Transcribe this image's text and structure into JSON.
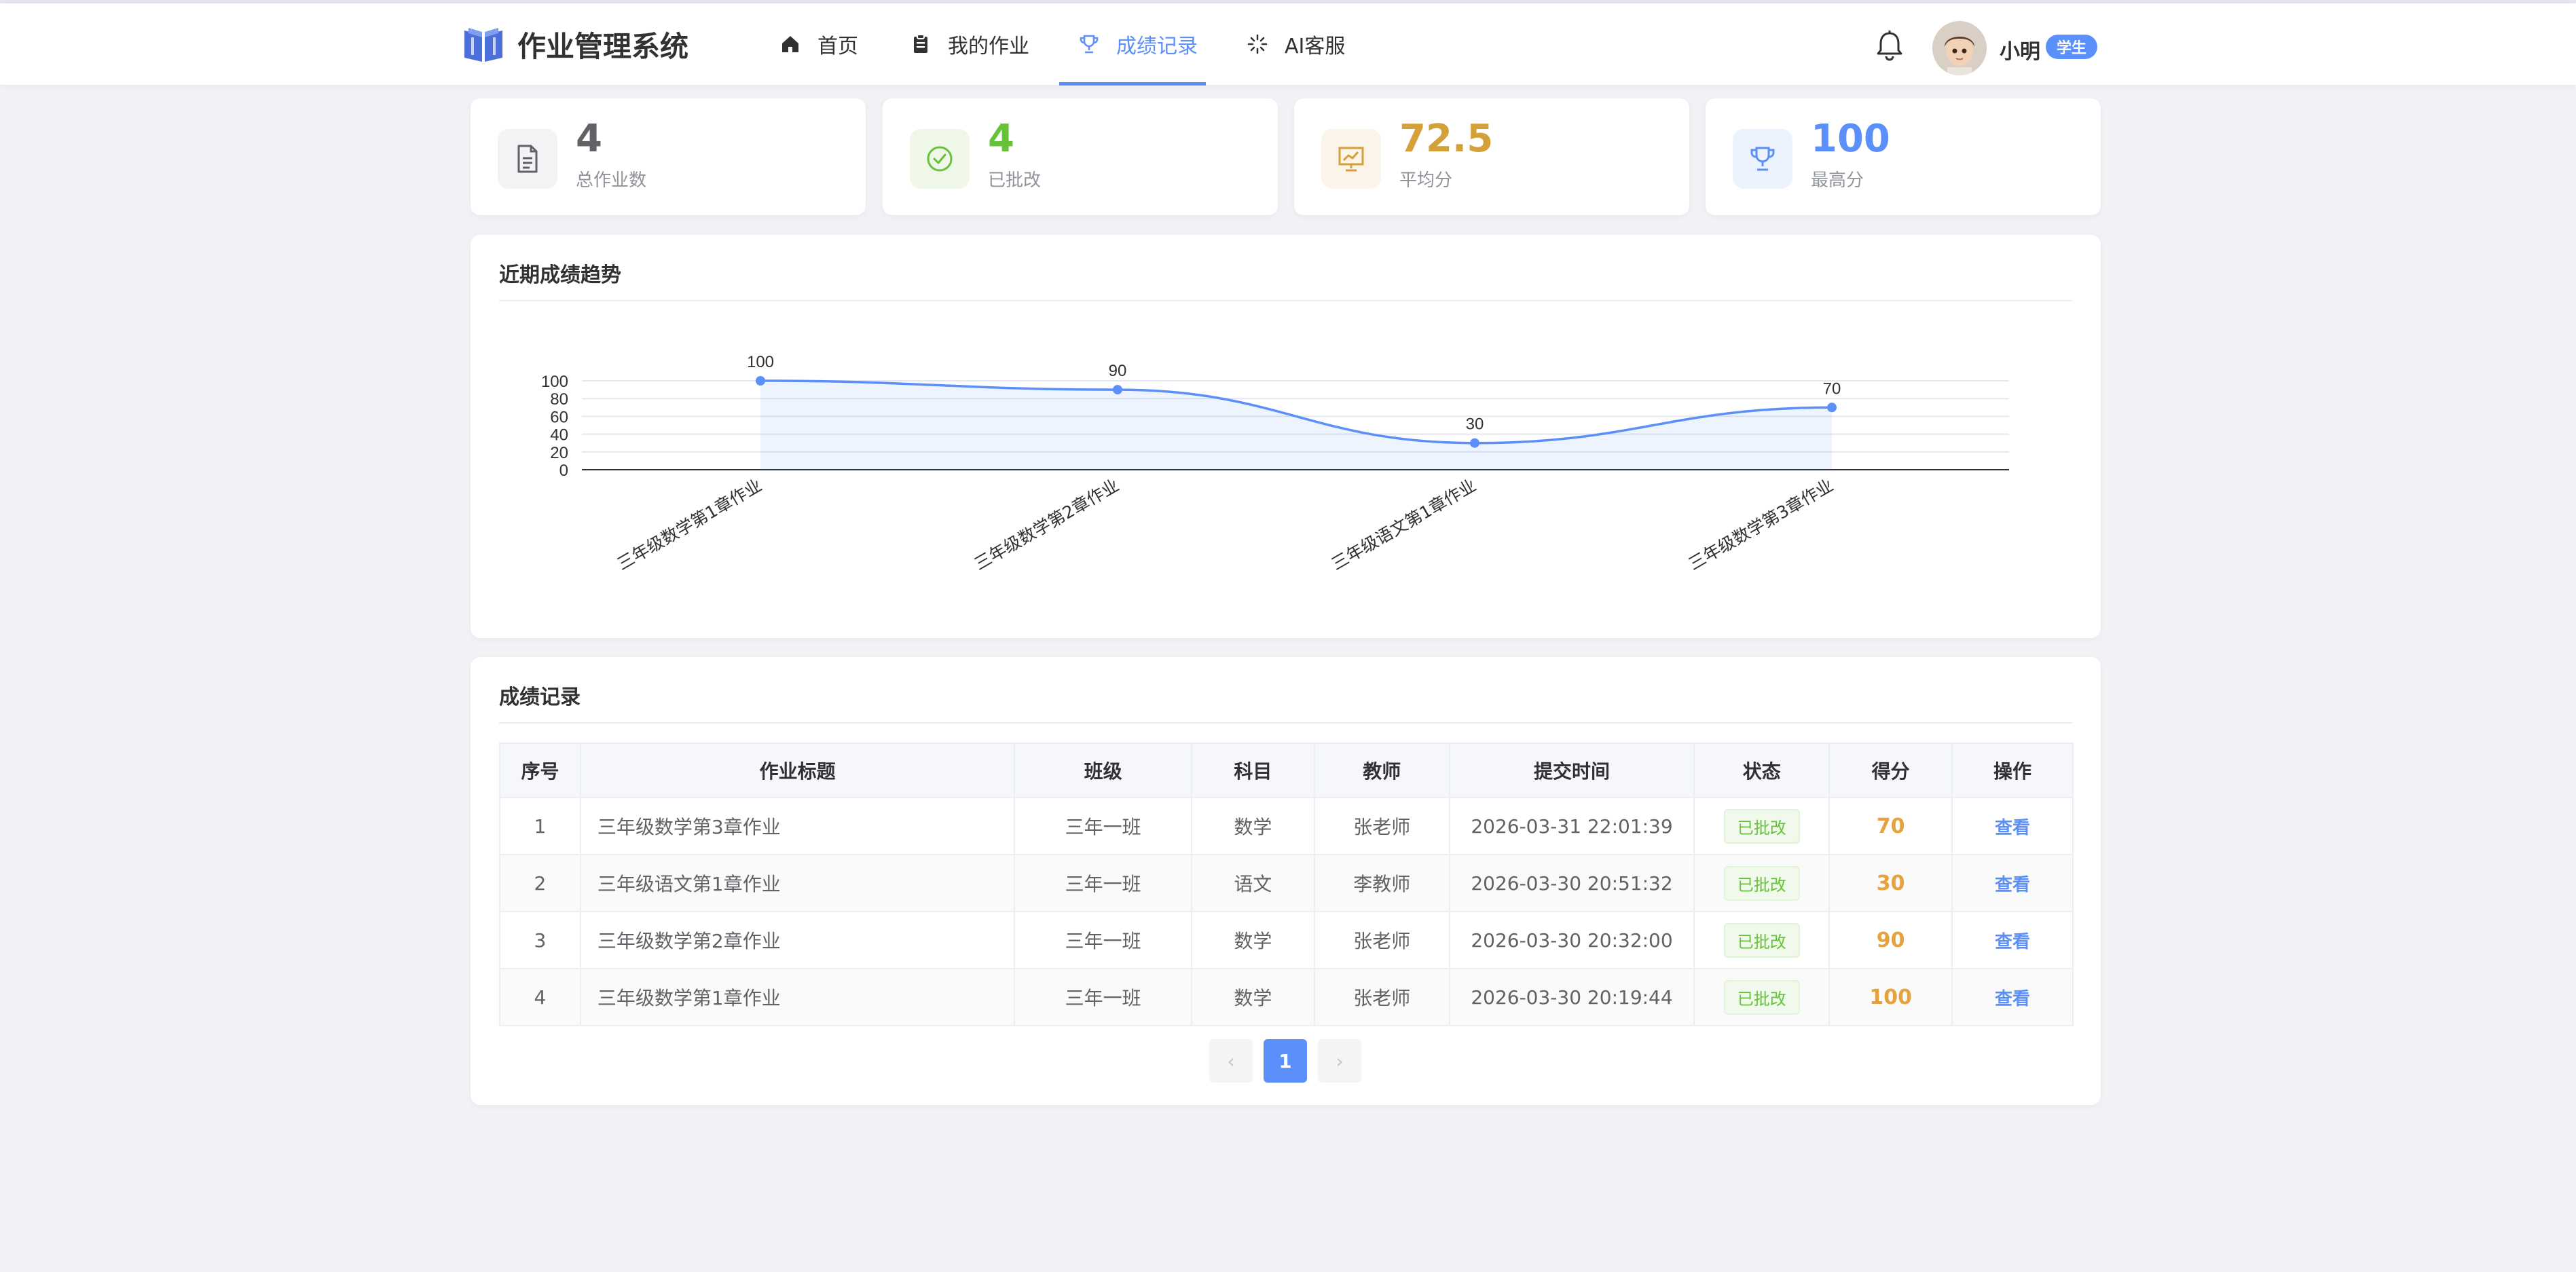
{
  "app": {
    "title": "作业管理系统"
  },
  "nav": {
    "items": [
      {
        "label": "首页",
        "icon": "home-icon"
      },
      {
        "label": "我的作业",
        "icon": "clipboard-icon"
      },
      {
        "label": "成绩记录",
        "icon": "trophy-icon",
        "active": true
      },
      {
        "label": "AI客服",
        "icon": "sparkle-icon"
      }
    ],
    "accent": "#5b8ff9"
  },
  "user": {
    "name": "小明",
    "role": "学生"
  },
  "stats": [
    {
      "value": "4",
      "label": "总作业数",
      "icon": "document-icon",
      "color": "#606266",
      "bg": "#f2f3f5"
    },
    {
      "value": "4",
      "label": "已批改",
      "icon": "check-circle-icon",
      "color": "#67c23a",
      "bg": "#eef7e8"
    },
    {
      "value": "72.5",
      "label": "平均分",
      "icon": "presentation-chart-icon",
      "color": "#d4a03a",
      "bg": "#fbf4e8"
    },
    {
      "value": "100",
      "label": "最高分",
      "icon": "trophy-icon",
      "color": "#5b8ff9",
      "bg": "#edf3fe"
    }
  ],
  "trend": {
    "title": "近期成绩趋势"
  },
  "chart_data": {
    "type": "area",
    "title": "",
    "categories": [
      "三年级数学第1章作业",
      "三年级数学第2章作业",
      "三年级语文第1章作业",
      "三年级数学第3章作业"
    ],
    "values": [
      100,
      90,
      30,
      70
    ],
    "ylim": [
      0,
      100
    ],
    "yticks": [
      0,
      20,
      40,
      60,
      80,
      100
    ],
    "grid": true,
    "legend": "none",
    "color": "#5b8ff9"
  },
  "records": {
    "title": "成绩记录",
    "columns": [
      "序号",
      "作业标题",
      "班级",
      "科目",
      "教师",
      "提交时间",
      "状态",
      "得分",
      "操作"
    ],
    "rows": [
      {
        "no": "1",
        "title": "三年级数学第3章作业",
        "class": "三年一班",
        "subject": "数学",
        "teacher": "张老师",
        "time": "2026-03-31 22:01:39",
        "status": "已批改",
        "score": "70",
        "action": "查看"
      },
      {
        "no": "2",
        "title": "三年级语文第1章作业",
        "class": "三年一班",
        "subject": "语文",
        "teacher": "李教师",
        "time": "2026-03-30 20:51:32",
        "status": "已批改",
        "score": "30",
        "action": "查看"
      },
      {
        "no": "3",
        "title": "三年级数学第2章作业",
        "class": "三年一班",
        "subject": "数学",
        "teacher": "张老师",
        "time": "2026-03-30 20:32:00",
        "status": "已批改",
        "score": "90",
        "action": "查看"
      },
      {
        "no": "4",
        "title": "三年级数学第1章作业",
        "class": "三年一班",
        "subject": "数学",
        "teacher": "张老师",
        "time": "2026-03-30 20:19:44",
        "status": "已批改",
        "score": "100",
        "action": "查看"
      }
    ]
  },
  "pagination": {
    "current": "1",
    "prev": "‹",
    "next": "›"
  }
}
